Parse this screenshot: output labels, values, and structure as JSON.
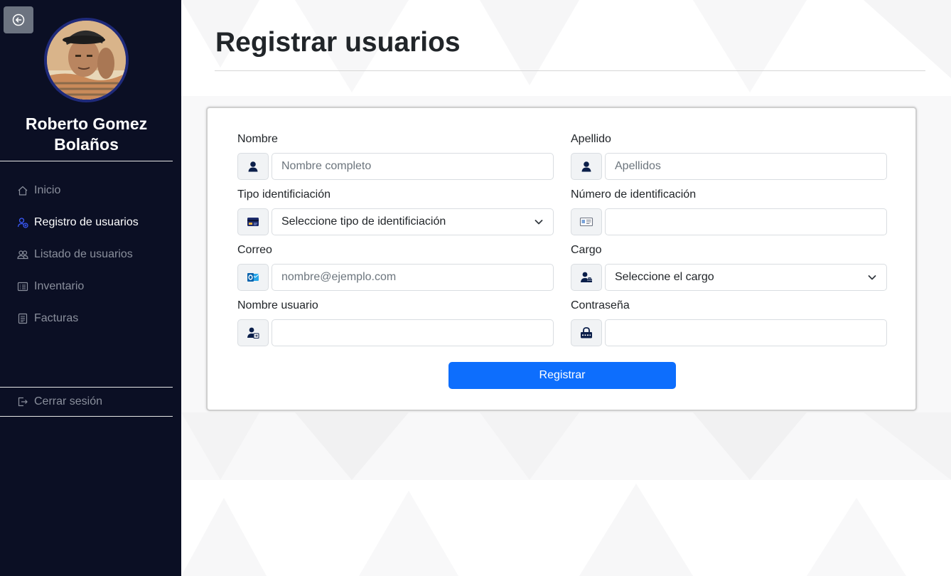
{
  "sidebar": {
    "user_name": "Roberto Gomez Bolaños",
    "nav": [
      {
        "label": "Inicio",
        "icon": "home-icon"
      },
      {
        "label": "Registro de usuarios",
        "icon": "user-add-icon",
        "active": true
      },
      {
        "label": "Listado de usuarios",
        "icon": "users-icon"
      },
      {
        "label": "Inventario",
        "icon": "list-icon"
      },
      {
        "label": "Facturas",
        "icon": "receipt-icon"
      }
    ],
    "logout_label": "Cerrar sesión"
  },
  "page": {
    "title": "Registrar usuarios"
  },
  "form": {
    "nombre": {
      "label": "Nombre",
      "placeholder": "Nombre completo",
      "value": ""
    },
    "apellido": {
      "label": "Apellido",
      "placeholder": "Apellidos",
      "value": ""
    },
    "tipo_id": {
      "label": "Tipo identificiación",
      "selected": "Seleccione tipo de identificiación"
    },
    "numero_id": {
      "label": "Número de identificación",
      "value": ""
    },
    "correo": {
      "label": "Correo",
      "placeholder": "nombre@ejemplo.com",
      "value": ""
    },
    "cargo": {
      "label": "Cargo",
      "selected": "Seleccione el cargo"
    },
    "usuario": {
      "label": "Nombre usuario",
      "value": ""
    },
    "contrasena": {
      "label": "Contraseña",
      "value": ""
    },
    "submit_label": "Registrar"
  },
  "colors": {
    "sidebar_bg": "#0b0f24",
    "accent": "#0d6efd",
    "active_icon": "#3b5bff"
  }
}
